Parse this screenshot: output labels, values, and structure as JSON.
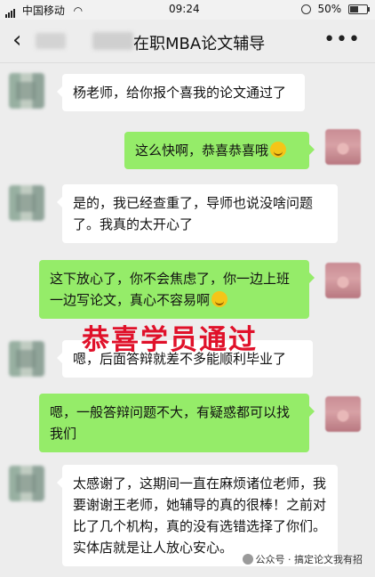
{
  "status_bar": {
    "carrier": "中国移动",
    "time": "09:24",
    "battery": "50%"
  },
  "header": {
    "title": "在职MBA论文辅导"
  },
  "messages": [
    {
      "side": "left",
      "text": "杨老师，给你报个喜我的论文通过了"
    },
    {
      "side": "right",
      "text": "这么快啊，恭喜恭喜哦"
    },
    {
      "side": "left",
      "text": "是的，我已经查重了，导师也说没啥问题了。我真的太开心了"
    },
    {
      "side": "right",
      "text": "这下放心了，你不会焦虑了，你一边上班一边写论文，真心不容易啊"
    },
    {
      "side": "left",
      "text": "嗯，后面答辩就差不多能顺利毕业了"
    },
    {
      "side": "right",
      "text": "嗯，一般答辩问题不大，有疑惑都可以找我们"
    },
    {
      "side": "left",
      "text": "太感谢了，这期间一直在麻烦诸位老师，我要谢谢王老师，她辅导的真的很棒！之前对比了几个机构，真的没有选错选择了你们。实体店就是让人放心安心。"
    }
  ],
  "overlay_text": "恭喜学员通过",
  "watermark": "公众号 · 搞定论文我有招"
}
